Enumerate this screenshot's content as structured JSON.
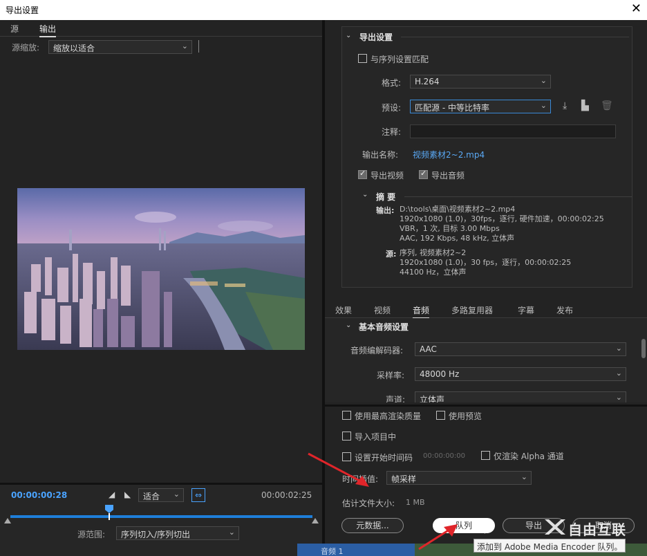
{
  "window": {
    "title": "导出设置",
    "close": "✕"
  },
  "left": {
    "tabs": [
      {
        "label": "源"
      },
      {
        "label": "输出"
      }
    ],
    "source_zoom_label": "源缩放:",
    "source_zoom_value": "缩放以适合",
    "timecode_start": "00:00:00:28",
    "timecode_end": "00:00:02:25",
    "fit_value": "适合",
    "source_range_label": "源范围:",
    "source_range_value": "序列切入/序列切出"
  },
  "export": {
    "section_title": "导出设置",
    "match_sequence_label": "与序列设置匹配",
    "format_label": "格式:",
    "format_value": "H.264",
    "preset_label": "预设:",
    "preset_value": "匹配源 - 中等比特率",
    "comments_label": "注释:",
    "output_name_label": "输出名称:",
    "output_name_value": "视频素材2~2.mp4",
    "export_video_label": "导出视频",
    "export_audio_label": "导出音频",
    "summary_title": "摘 要",
    "summary_output_label": "输出:",
    "summary_output_lines": [
      "D:\\tools\\桌面\\视频素材2~2.mp4",
      "1920x1080 (1.0)，30fps，逐行, 硬件加速，00:00:02:25",
      "VBR，1 次, 目标 3.00 Mbps",
      "AAC, 192 Kbps, 48  kHz, 立体声"
    ],
    "summary_source_label": "源:",
    "summary_source_lines": [
      "序列, 视频素材2~2",
      "1920x1080 (1.0)，30 fps，逐行，00:00:02:25",
      "44100 Hz，立体声"
    ]
  },
  "mid_tabs": [
    "效果",
    "视频",
    "音频",
    "多路复用器",
    "字幕",
    "发布"
  ],
  "audio": {
    "section_title": "基本音频设置",
    "codec_label": "音频编解码器:",
    "codec_value": "AAC",
    "sample_rate_label": "采样率:",
    "sample_rate_value": "48000 Hz",
    "channels_label": "声道:",
    "channels_value": "立体声"
  },
  "bottom": {
    "max_render_label": "使用最高渲染质量",
    "use_preview_label": "使用预览",
    "import_project_label": "导入项目中",
    "set_start_tc_label": "设置开始时间码",
    "start_tc_value": "00:00:00:00",
    "alpha_only_label": "仅渲染 Alpha 通道",
    "time_interp_label": "时间插值:",
    "time_interp_value": "帧采样",
    "est_size_label": "估计文件大小:",
    "est_size_value": "1 MB",
    "metadata_button": "元数据...",
    "queue_button": "队列",
    "export_button": "导出",
    "cancel_button": "取消",
    "tooltip": "添加到 Adobe Media Encoder 队列。",
    "audio_track_label": "音频 1"
  },
  "watermark": "自由互联",
  "colors": {
    "accent_blue": "#1e7fd9",
    "link_blue": "#5aa9f5",
    "arrow_red": "#e0252a"
  }
}
